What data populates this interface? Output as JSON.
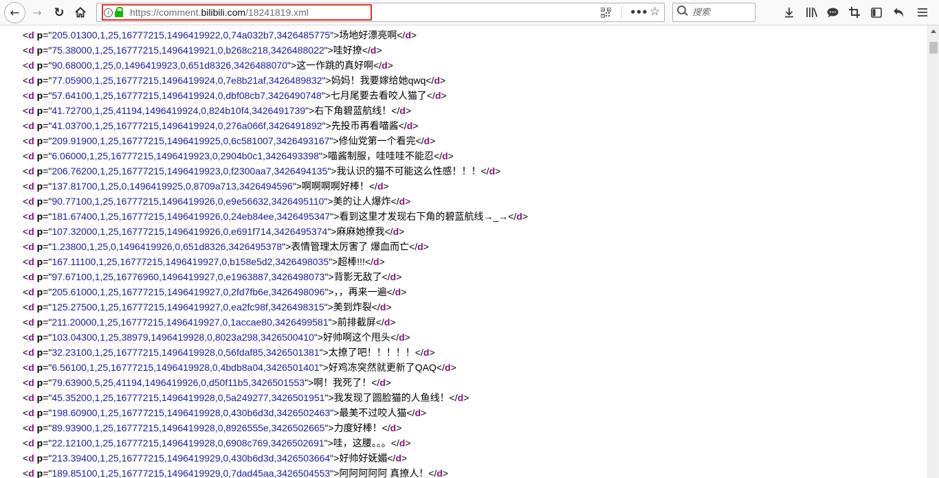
{
  "browser": {
    "url_prefix": "https://comment.",
    "url_domain": "bilibili.com",
    "url_path": "/18241819.xml",
    "search_placeholder": "搜索",
    "icons": [
      "back-arrow-icon",
      "forward-arrow-icon",
      "reload-icon",
      "home-icon",
      "info-icon",
      "lock-icon",
      "qr-code-icon",
      "page-actions-menu-icon",
      "bookmark-star-icon",
      "search-icon",
      "download-icon",
      "library-icon",
      "chat-icon",
      "crop-icon",
      "sidebar-icon",
      "undo-icon",
      "hamburger-menu-icon"
    ]
  },
  "xml": {
    "tag": "d",
    "attr": "p",
    "lines": [
      {
        "p": "205.01300,1,25,16777215,1496419922,0,74a032b7,3426485775",
        "text": "场地好漂亮啊"
      },
      {
        "p": "75.38000,1,25,16777215,1496419921,0,b268c218,3426488022",
        "text": "哇好撩"
      },
      {
        "p": "90.68000,1,25,0,1496419923,0,651d8326,3426488070",
        "text": "这一作跳的真好啊"
      },
      {
        "p": "77.05900,1,25,16777215,1496419924,0,7e8b21af,3426489832",
        "text": "妈妈！我要嫁给她qwq"
      },
      {
        "p": "57.64100,1,25,16777215,1496419924,0,dbf08cb7,3426490748",
        "text": "七月尾要去看咬人猫了"
      },
      {
        "p": "41.72700,1,25,41194,1496419924,0,824b10f4,3426491739",
        "text": "右下角碧蓝航线！"
      },
      {
        "p": "41.03700,1,25,16777215,1496419924,0,276a066f,3426491892",
        "text": "先投币再看喵酱"
      },
      {
        "p": "209.91900,1,25,16777215,1496419925,0,6c581007,3426493167",
        "text": "修仙党第一个看完"
      },
      {
        "p": "6.06000,1,25,16777215,1496419923,0,2904b0c1,3426493398",
        "text": "喵酱制服，哇哇哇不能忍"
      },
      {
        "p": "206.76200,1,25,16777215,1496419923,0,f2300aa7,3426494135",
        "text": "我认识的猫不可能这么性感！！！"
      },
      {
        "p": "137.81700,1,25,0,1496419925,0,8709a713,3426494596",
        "text": "啊啊啊啊好棒！"
      },
      {
        "p": "90.77100,1,25,16777215,1496419926,0,e9e56632,3426495110",
        "text": "美的让人爆炸"
      },
      {
        "p": "181.67400,1,25,16777215,1496419926,0,24eb84ee,3426495347",
        "text": "看到这里才发现右下角的碧蓝航线→_→"
      },
      {
        "p": "107.32000,1,25,16777215,1496419926,0,e691f714,3426495374",
        "text": "麻麻她撩我"
      },
      {
        "p": "1.23800,1,25,0,1496419926,0,651d8326,3426495378",
        "text": "表情管理太厉害了 爆血而亡"
      },
      {
        "p": "167.11100,1,25,16777215,1496419927,0,b158e5d2,3426498035",
        "text": "超棒!!!"
      },
      {
        "p": "97.67100,1,25,16776960,1496419927,0,e1963887,3426498073",
        "text": "背影无敌了"
      },
      {
        "p": "205.61000,1,25,16777215,1496419927,0,2fd7fb6e,3426498096",
        "text": "，，再来一遍"
      },
      {
        "p": "125.27500,1,25,16777215,1496419927,0,ea2fc98f,3426498315",
        "text": "美到炸裂"
      },
      {
        "p": "211.20000,1,25,16777215,1496419927,0,1accae80,3426499581",
        "text": "前排截屏"
      },
      {
        "p": "103.04300,1,25,38979,1496419928,0,8023a298,3426500410",
        "text": "好帅啊这个甩头"
      },
      {
        "p": "32.23100,1,25,16777215,1496419928,0,56fdaf85,3426501381",
        "text": "太撩了吧！！！！！"
      },
      {
        "p": "6.56100,1,25,16777215,1496419928,0,4bdb8a04,3426501401",
        "text": "好鸡冻突然就更新了QAQ"
      },
      {
        "p": "79.63900,5,25,41194,1496419926,0,d50f11b5,3426501553",
        "text": "啊！我死了！"
      },
      {
        "p": "45.35200,1,25,16777215,1496419928,0,5a249277,3426501951",
        "text": "我发现了圆脸猫的人鱼线！"
      },
      {
        "p": "198.60900,1,25,16777215,1496419928,0,430b6d3d,3426502463",
        "text": "最美不过咬人猫"
      },
      {
        "p": "89.93900,1,25,16777215,1496419928,0,8926555e,3426502665",
        "text": "力度好棒！"
      },
      {
        "p": "22.12100,1,25,16777215,1496419928,0,6908c769,3426502691",
        "text": "哇，这腰。。。"
      },
      {
        "p": "213.39400,1,25,16777215,1496419929,0,430b6d3d,3426503664",
        "text": "好帅好妩媚"
      },
      {
        "p": "189.85100,1,25,16777215,1496419929,0,7dad45aa,3426504553",
        "text": "阿阿阿阿阿 真撩人！"
      }
    ]
  }
}
